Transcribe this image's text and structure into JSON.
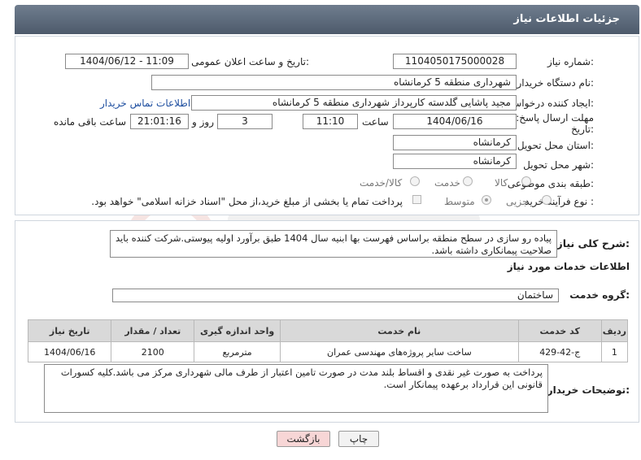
{
  "header": {
    "title": "جزئیات اطلاعات نیاز"
  },
  "fields": {
    "need_number_label": "شماره نیاز:",
    "need_number": "1104050175000028",
    "announce_label": "تاریخ و ساعت اعلان عمومی:",
    "announce_value": "1404/06/12 - 11:09",
    "buyer_label": "نام دستگاه خریدار:",
    "buyer_value": "شهرداری منطقه 5 کرمانشاه",
    "creator_label": "ایجاد کننده درخواست:",
    "creator_value": "مجید پاشایی گلدسته کارپرداز شهرداری منطقه 5 کرمانشاه",
    "contact_link": "اطلاعات تماس خریدار",
    "deadline_label_1": "مهلت ارسال پاسخ: تا",
    "deadline_label_2": "تاریخ:",
    "deadline_date": "1404/06/16",
    "time_label": "ساعت",
    "deadline_time": "11:10",
    "days_value": "3",
    "days_label": "روز و",
    "remaining_time": "21:01:16",
    "remaining_label": "ساعت باقی مانده",
    "province_label": "استان محل تحویل:",
    "province_value": "کرمانشاه",
    "city_label": "شهر محل تحویل:",
    "city_value": "کرمانشاه",
    "category_label": "طبقه بندی موضوعی:",
    "category_options": [
      "کالا",
      "خدمت",
      "کالا/خدمت"
    ],
    "process_label": "نوع فرآیند خرید :",
    "process_options": [
      "جزیی",
      "متوسط"
    ],
    "payment_text": "پرداخت تمام یا بخشی از مبلغ خرید،از محل \"اسناد خزانه اسلامی\" خواهد بود."
  },
  "description": {
    "label": "شرح کلی نیاز:",
    "text": "پیاده رو سازی در سطح منطقه براساس فهرست بها ابنیه سال 1404 طبق برآورد اولیه پیوستی.شرکت کننده باید صلاحیت پیمانکاری داشته باشد."
  },
  "services": {
    "section_title": "اطلاعات خدمات مورد نیاز",
    "group_label": "گروه خدمت:",
    "group_value": "ساختمان",
    "columns": [
      "ردیف",
      "کد خدمت",
      "نام خدمت",
      "واحد اندازه گیری",
      "تعداد / مقدار",
      "تاریخ نیاز"
    ],
    "rows": [
      [
        "1",
        "ج-42-429",
        "ساخت سایر پروژه‌های مهندسی عمران",
        "مترمربع",
        "2100",
        "1404/06/16"
      ]
    ]
  },
  "buyer_notes": {
    "label": "توضیحات خریدار:",
    "text": "پرداخت به صورت غیر نقدی و اقساط بلند مدت در صورت تامین اعتبار از طرف مالی شهرداری مرکز می باشد.کلیه کسورات قانونی این قرارداد برعهده پیمانکار است."
  },
  "buttons": {
    "print": "چاپ",
    "back": "بازگشت"
  },
  "colors": {
    "header": "#5d6a7b",
    "back_button": "#f7d6d6",
    "link": "#1f4fa0"
  }
}
